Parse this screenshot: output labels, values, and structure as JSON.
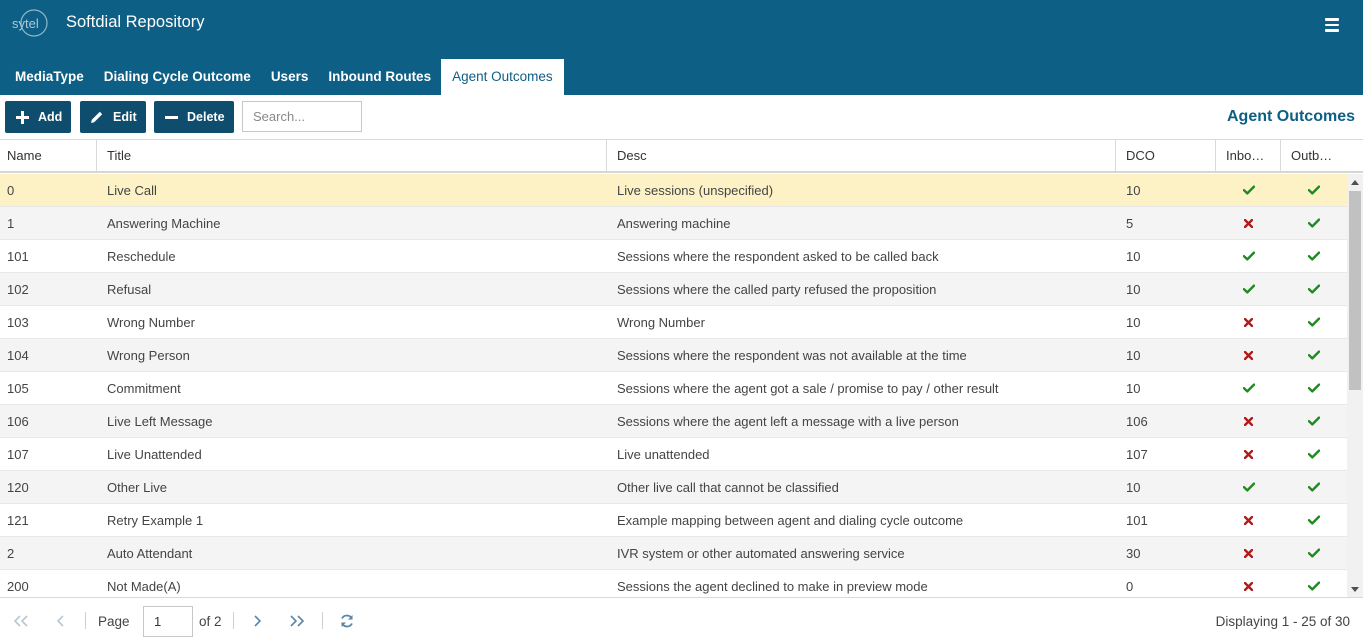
{
  "app": {
    "logo_text": "sytel",
    "title": "Softdial Repository"
  },
  "tabs": [
    {
      "label": "MediaType",
      "active": false
    },
    {
      "label": "Dialing Cycle Outcome",
      "active": false
    },
    {
      "label": "Users",
      "active": false
    },
    {
      "label": "Inbound Routes",
      "active": false
    },
    {
      "label": "Agent Outcomes",
      "active": true
    }
  ],
  "toolbar": {
    "add_label": "Add",
    "edit_label": "Edit",
    "delete_label": "Delete",
    "search_placeholder": "Search...",
    "heading": "Agent Outcomes"
  },
  "grid": {
    "columns": [
      "Name",
      "Title",
      "Desc",
      "DCO",
      "Inbo…",
      "Outb…"
    ],
    "rows": [
      {
        "name": "0",
        "title": "Live Call",
        "desc": "Live sessions (unspecified)",
        "dco": "10",
        "inbound": true,
        "outbound": true,
        "selected": true
      },
      {
        "name": "1",
        "title": "Answering Machine",
        "desc": "Answering machine",
        "dco": "5",
        "inbound": false,
        "outbound": true
      },
      {
        "name": "101",
        "title": "Reschedule",
        "desc": "Sessions where the respondent asked to be called back",
        "dco": "10",
        "inbound": true,
        "outbound": true
      },
      {
        "name": "102",
        "title": "Refusal",
        "desc": "Sessions where the called party refused the proposition",
        "dco": "10",
        "inbound": true,
        "outbound": true
      },
      {
        "name": "103",
        "title": "Wrong Number",
        "desc": "Wrong Number",
        "dco": "10",
        "inbound": false,
        "outbound": true
      },
      {
        "name": "104",
        "title": "Wrong Person",
        "desc": "Sessions where the respondent was not available at the time",
        "dco": "10",
        "inbound": false,
        "outbound": true
      },
      {
        "name": "105",
        "title": "Commitment",
        "desc": "Sessions where the agent got a sale / promise to pay / other result",
        "dco": "10",
        "inbound": true,
        "outbound": true
      },
      {
        "name": "106",
        "title": "Live Left Message",
        "desc": "Sessions where the agent left a message with a live person",
        "dco": "106",
        "inbound": false,
        "outbound": true
      },
      {
        "name": "107",
        "title": "Live Unattended",
        "desc": "Live unattended",
        "dco": "107",
        "inbound": false,
        "outbound": true
      },
      {
        "name": "120",
        "title": "Other Live",
        "desc": "Other live call that cannot be classified",
        "dco": "10",
        "inbound": true,
        "outbound": true
      },
      {
        "name": "121",
        "title": "Retry Example 1",
        "desc": "Example mapping between agent and dialing cycle outcome",
        "dco": "101",
        "inbound": false,
        "outbound": true
      },
      {
        "name": "2",
        "title": "Auto Attendant",
        "desc": "IVR system or other automated answering service",
        "dco": "30",
        "inbound": false,
        "outbound": true
      },
      {
        "name": "200",
        "title": "Not Made(A)",
        "desc": "Sessions the agent declined to make in preview mode",
        "dco": "0",
        "inbound": false,
        "outbound": true
      }
    ]
  },
  "pager": {
    "page_label": "Page",
    "page_value": "1",
    "of_label": "of 2",
    "display_text": "Displaying 1 - 25 of 30"
  },
  "colors": {
    "header_bg": "#0e5f85",
    "button_bg": "#0e4d6e",
    "selected_row": "#fdf2c5",
    "check": "#1f8a1f",
    "cross": "#b01c1c"
  }
}
